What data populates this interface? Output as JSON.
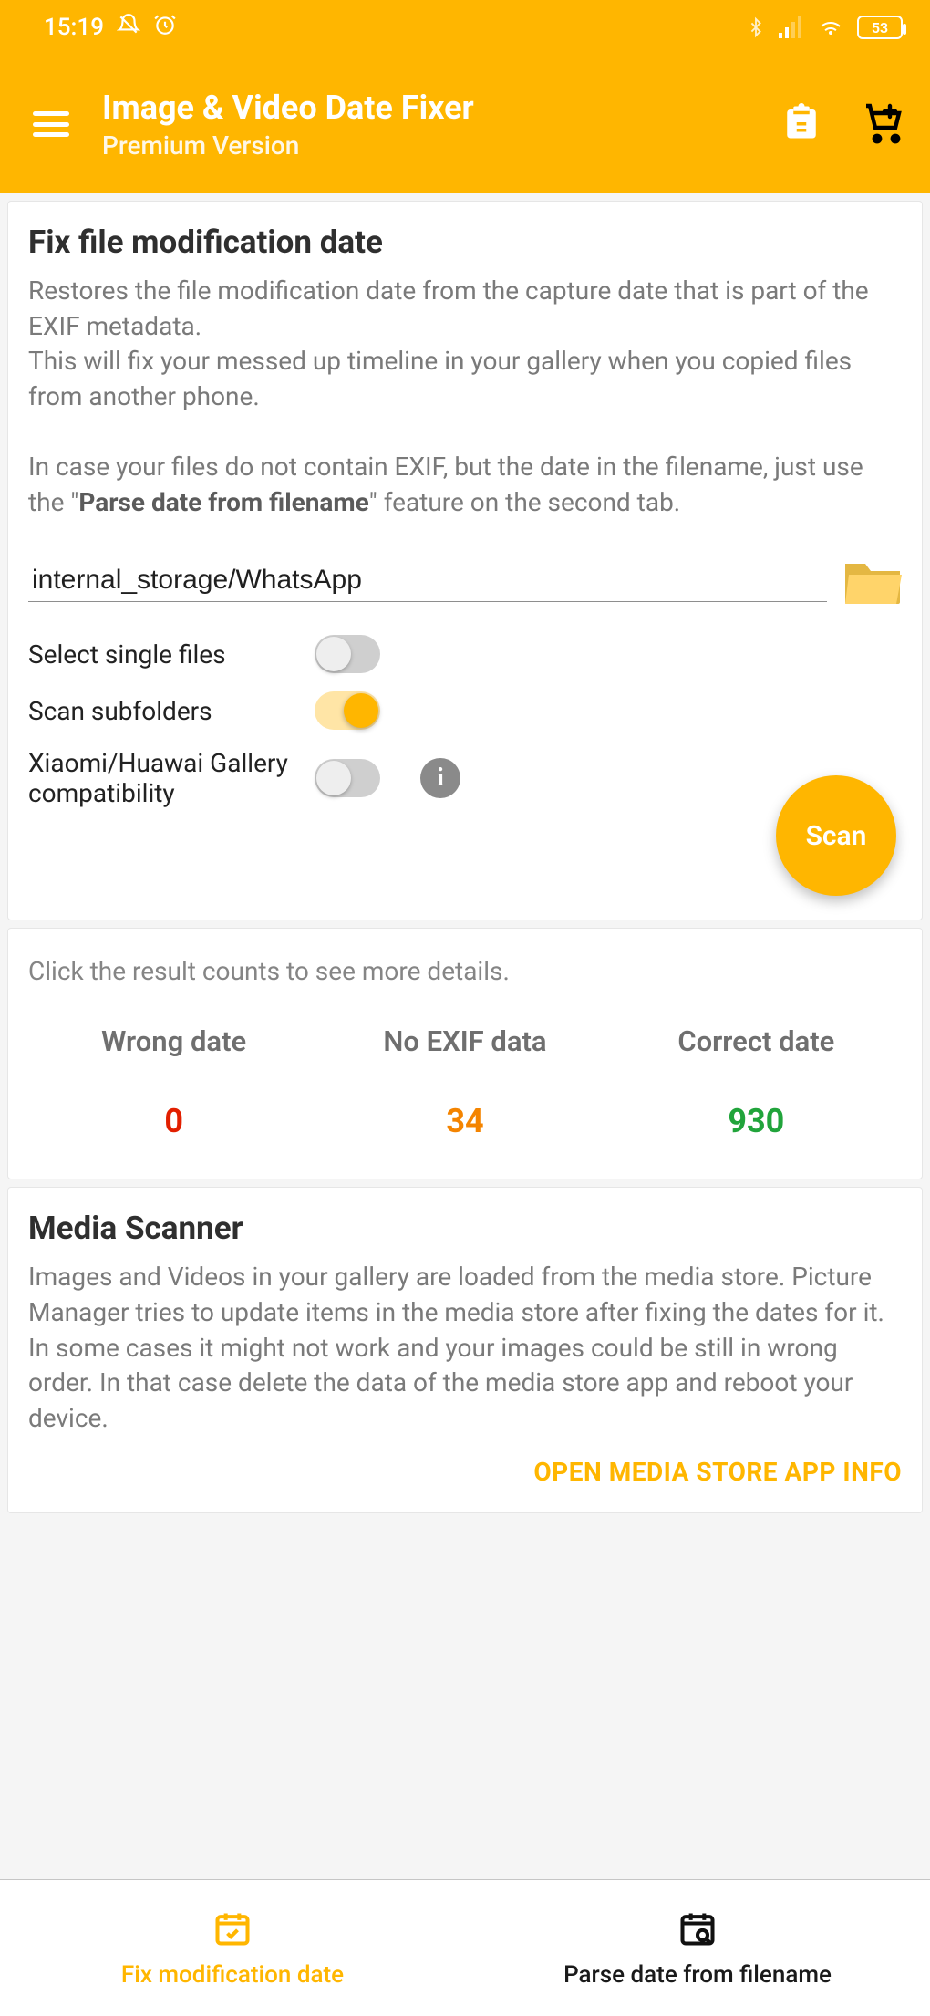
{
  "status": {
    "time": "15:19",
    "battery": "53"
  },
  "appbar": {
    "title": "Image & Video Date Fixer",
    "subtitle": "Premium Version"
  },
  "card_fix": {
    "title": "Fix file modification date",
    "desc1": "Restores the file modification date from the capture date that is part of the EXIF metadata.",
    "desc2": "This will fix your messed up timeline in your gallery when you copied files from another phone.",
    "desc3a": "In case your files do not contain EXIF, but the date in the filename, just use the \"",
    "desc3b": "Parse date from filename",
    "desc3c": "\" feature on the second tab.",
    "path": "internal_storage/WhatsApp",
    "options": {
      "single_files": "Select single files",
      "subfolders": "Scan subfolders",
      "compat": "Xiaomi/Huawai Gallery compatibility"
    },
    "scan_label": "Scan"
  },
  "results": {
    "hint": "Click the result counts to see more details.",
    "wrong_label": "Wrong date",
    "noexif_label": "No EXIF data",
    "correct_label": "Correct date",
    "wrong": "0",
    "noexif": "34",
    "correct": "930"
  },
  "media_scanner": {
    "title": "Media Scanner",
    "desc": "Images and Videos in your gallery are loaded from the media store. Picture Manager tries to update items in the media store after fixing the dates for it. In some cases it might not work and your images could be still in wrong order. In that case delete the data of the media store app and reboot your device.",
    "open_label": "OPEN MEDIA STORE APP INFO"
  },
  "bottom_nav": {
    "tab1": "Fix modification date",
    "tab2": "Parse date from filename"
  }
}
